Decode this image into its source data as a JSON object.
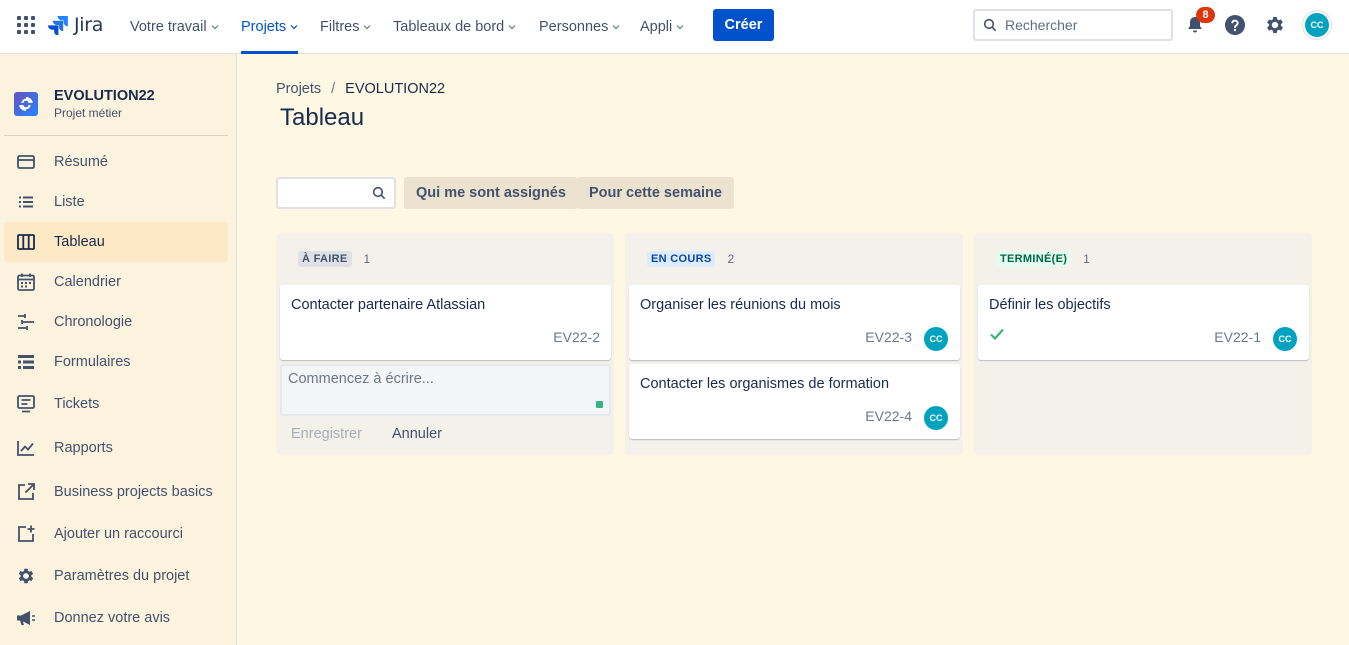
{
  "app": {
    "name": "Jira"
  },
  "nav": {
    "items": [
      {
        "label": "Votre travail"
      },
      {
        "label": "Projets"
      },
      {
        "label": "Filtres"
      },
      {
        "label": "Tableaux de bord"
      },
      {
        "label": "Personnes"
      },
      {
        "label": "Appli"
      }
    ],
    "create_label": "Créer",
    "search_placeholder": "Rechercher",
    "notification_count": "8",
    "avatar_initials": "CC"
  },
  "colors": {
    "brand": "#0052cc",
    "sidebar_bg": "#fcf3df",
    "main_bg": "#fef7e3",
    "avatar": "#00a3bf",
    "badge": "#de350b"
  },
  "sidebar": {
    "project_name": "EVOLUTION22",
    "project_type": "Projet métier",
    "items": [
      {
        "label": "Résumé",
        "icon": "summary-icon"
      },
      {
        "label": "Liste",
        "icon": "list-icon"
      },
      {
        "label": "Tableau",
        "icon": "board-icon"
      },
      {
        "label": "Calendrier",
        "icon": "calendar-icon"
      },
      {
        "label": "Chronologie",
        "icon": "timeline-icon"
      },
      {
        "label": "Formulaires",
        "icon": "forms-icon"
      },
      {
        "label": "Tickets",
        "icon": "tickets-icon"
      },
      {
        "label": "Rapports",
        "icon": "reports-icon"
      },
      {
        "label": "Business projects basics",
        "icon": "external-link-icon"
      },
      {
        "label": "Ajouter un raccourci",
        "icon": "add-shortcut-icon"
      },
      {
        "label": "Paramètres du projet",
        "icon": "gear-icon"
      },
      {
        "label": "Donnez votre avis",
        "icon": "megaphone-icon"
      }
    ]
  },
  "main": {
    "breadcrumb": [
      "Projets",
      "/",
      "EVOLUTION22"
    ],
    "title": "Tableau",
    "filters": [
      "Qui me sont assignés",
      "Pour cette semaine"
    ],
    "columns": [
      {
        "status": "À FAIRE",
        "count": "1",
        "cards": [
          {
            "title": "Contacter partenaire Atlassian",
            "key": "EV22-2"
          }
        ],
        "compose_placeholder": "Commencez à écrire...",
        "save_label": "Enregistrer",
        "cancel_label": "Annuler"
      },
      {
        "status": "EN COURS",
        "count": "2",
        "cards": [
          {
            "title": "Organiser les réunions du mois",
            "key": "EV22-3",
            "avatar": "CC"
          },
          {
            "title": "Contacter les organismes de formation",
            "key": "EV22-4",
            "avatar": "CC"
          }
        ]
      },
      {
        "status": "TERMINÉ(E)",
        "count": "1",
        "cards": [
          {
            "title": "Définir les objectifs",
            "key": "EV22-1",
            "avatar": "CC",
            "done": true
          }
        ]
      }
    ]
  }
}
